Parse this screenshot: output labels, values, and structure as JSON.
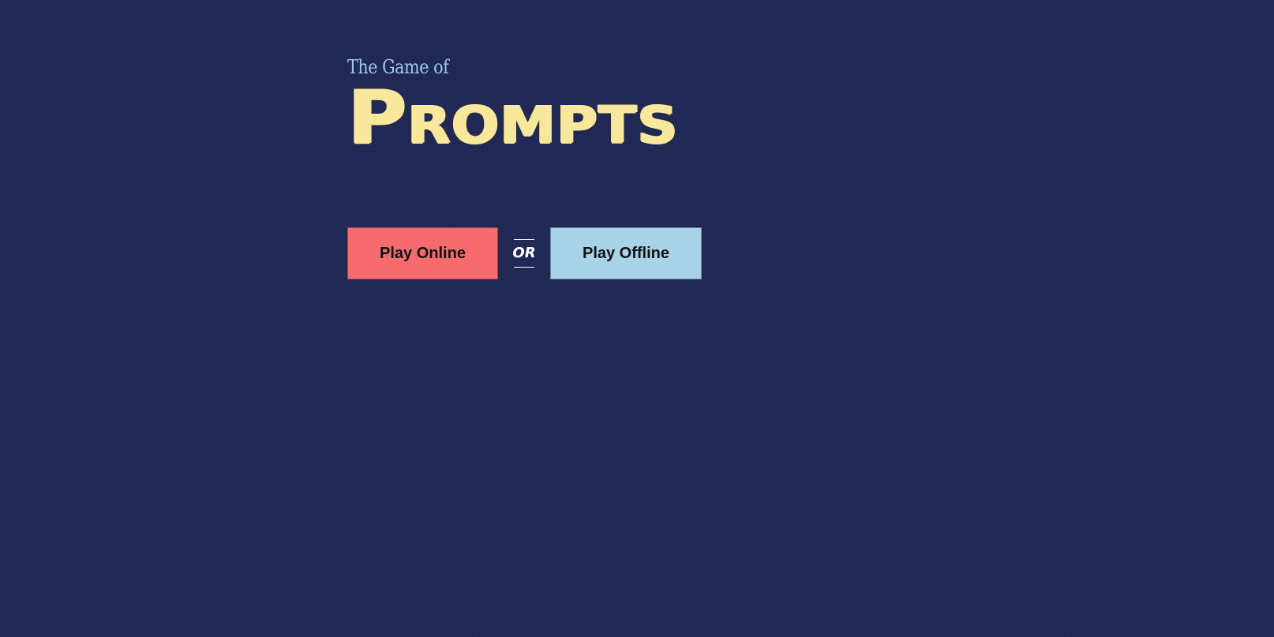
{
  "header": {
    "subtitle": "The Game of",
    "title": "Prompts"
  },
  "actions": {
    "play_online_label": "Play Online",
    "separator_label": "OR",
    "play_offline_label": "Play Offline"
  },
  "colors": {
    "background": "#202853",
    "subtitle": "#9fc9ea",
    "title": "#f9e89b",
    "play_online": "#f66c6e",
    "play_offline": "#a8d2e8",
    "separator": "#ffffff"
  }
}
